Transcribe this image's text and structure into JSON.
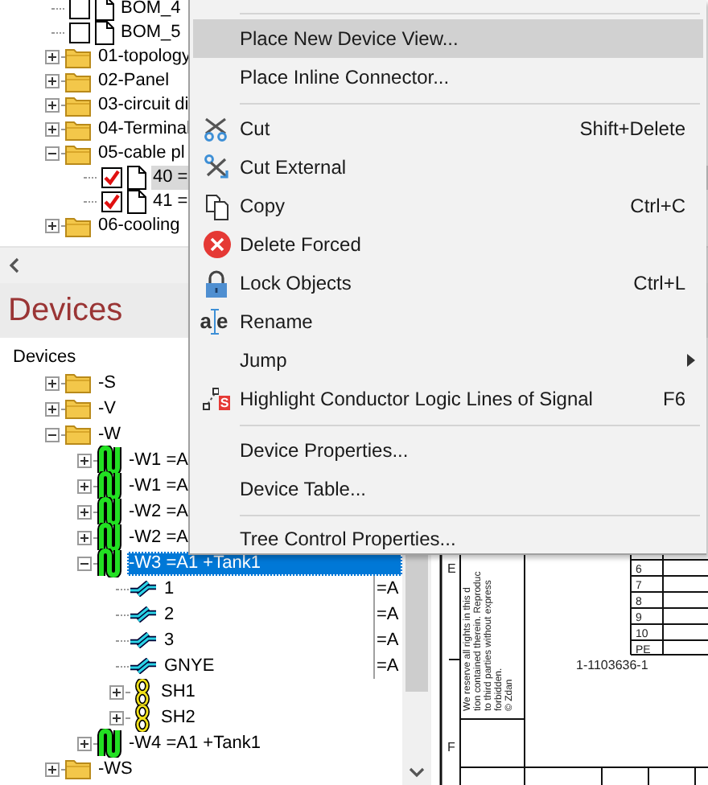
{
  "top_tree": {
    "items": [
      {
        "label": "BOM_4",
        "kind": "document",
        "checked": false,
        "selected": false
      },
      {
        "label": "BOM_5",
        "kind": "document",
        "checked": false,
        "selected": false
      },
      {
        "label": "01-topology",
        "kind": "folder",
        "expanded": false,
        "selected": false
      },
      {
        "label": "02-Panel",
        "kind": "folder",
        "expanded": false,
        "selected": false
      },
      {
        "label": "03-circuit di",
        "kind": "folder",
        "expanded": false,
        "selected": false
      },
      {
        "label": "04-Terminal",
        "kind": "folder",
        "expanded": false,
        "selected": false
      },
      {
        "label": "05-cable pl",
        "kind": "folder",
        "expanded": true,
        "selected": false,
        "children": [
          {
            "label": "40 =",
            "kind": "document",
            "checked": true,
            "selected": true
          },
          {
            "label": "41 =",
            "kind": "document",
            "checked": true,
            "selected": false
          }
        ]
      },
      {
        "label": "06-cooling",
        "kind": "folder",
        "expanded": false,
        "selected": false
      }
    ]
  },
  "devices_panel": {
    "title": "Devices",
    "items": [
      {
        "label": "Devices",
        "kind": "root",
        "selected": false,
        "children": [
          {
            "label": "-S",
            "kind": "folder",
            "expanded": false,
            "selected": false
          },
          {
            "label": "-V",
            "kind": "folder",
            "expanded": false,
            "selected": false
          },
          {
            "label": "-W",
            "kind": "folder",
            "expanded": true,
            "selected": false,
            "children": [
              {
                "label": "-W1 =A",
                "kind": "cable",
                "expanded": false,
                "selected": false
              },
              {
                "label": "-W1 =A",
                "kind": "cable",
                "expanded": false,
                "selected": false
              },
              {
                "label": "-W2 =A",
                "kind": "cable",
                "expanded": false,
                "selected": false
              },
              {
                "label": "-W2 =A",
                "kind": "cable",
                "expanded": false,
                "selected": false
              },
              {
                "label": "-W3 =A1 +Tank1",
                "kind": "cable",
                "expanded": true,
                "selected": true,
                "children": [
                  {
                    "label": "1",
                    "kind": "wire",
                    "selected": false,
                    "column_2": "=A"
                  },
                  {
                    "label": "2",
                    "kind": "wire",
                    "selected": false,
                    "column_2": "=A"
                  },
                  {
                    "label": "3",
                    "kind": "wire",
                    "selected": false,
                    "column_2": "=A"
                  },
                  {
                    "label": "GNYE",
                    "kind": "wire",
                    "selected": false,
                    "column_2": "=A"
                  },
                  {
                    "label": "SH1",
                    "kind": "shield",
                    "expanded": false,
                    "selected": false
                  },
                  {
                    "label": "SH2",
                    "kind": "shield",
                    "expanded": false,
                    "selected": false
                  }
                ]
              },
              {
                "label": "-W4 =A1 +Tank1",
                "kind": "cable",
                "expanded": false,
                "selected": false
              }
            ]
          },
          {
            "label": "-WS",
            "kind": "folder",
            "expanded": false,
            "selected": false
          }
        ]
      }
    ]
  },
  "drawing": {
    "zone_labels": [
      "E",
      "F"
    ],
    "table_rows": [
      "6",
      "7",
      "8",
      "9",
      "10",
      "PE"
    ],
    "part_number": "1-1103636-1",
    "copyright_lines": [
      "We reserve all rights in this d",
      "tion contained therein. Reproduc",
      "to third parties without express",
      "forbidden.",
      "© Zdan"
    ]
  },
  "context_menu": {
    "items": [
      {
        "kind": "separator"
      },
      {
        "kind": "item",
        "label": "Place New Device View...",
        "selected": true
      },
      {
        "kind": "item",
        "label": "Place Inline Connector...",
        "selected": false
      },
      {
        "kind": "separator"
      },
      {
        "kind": "item",
        "label": "Cut",
        "shortcut": "Shift+Delete",
        "selected": false
      },
      {
        "kind": "item",
        "label": "Cut External",
        "selected": false
      },
      {
        "kind": "item",
        "label": "Copy",
        "shortcut": "Ctrl+C",
        "selected": false
      },
      {
        "kind": "item",
        "label": "Delete Forced",
        "selected": false
      },
      {
        "kind": "item",
        "label": "Lock Objects",
        "shortcut": "Ctrl+L",
        "selected": false
      },
      {
        "kind": "item",
        "label": "Rename",
        "icon_text": "ae",
        "selected": false
      },
      {
        "kind": "item",
        "label": "Jump",
        "submenu": true,
        "selected": false
      },
      {
        "kind": "item",
        "label": "Highlight Conductor Logic Lines of Signal",
        "icon_text": "S",
        "shortcut": "F6",
        "selected": false
      },
      {
        "kind": "separator"
      },
      {
        "kind": "item",
        "label": "Device Properties...",
        "selected": false
      },
      {
        "kind": "item",
        "label": "Device Table...",
        "selected": false
      },
      {
        "kind": "separator"
      },
      {
        "kind": "item",
        "label": "Tree Control Properties...",
        "selected": false
      }
    ]
  }
}
